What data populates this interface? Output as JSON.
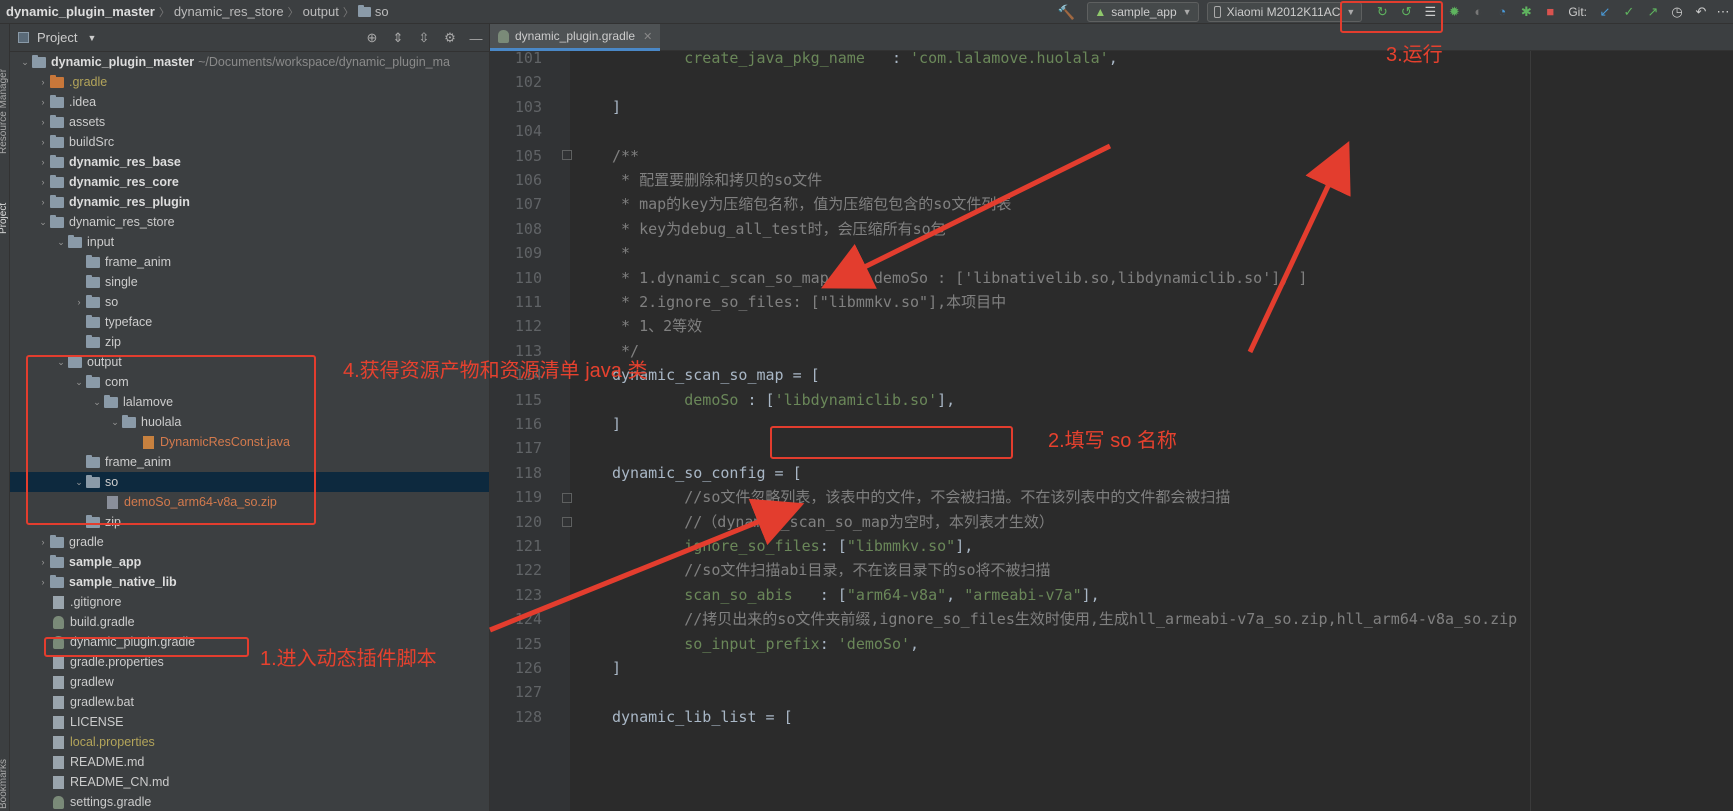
{
  "breadcrumb": [
    "dynamic_plugin_master",
    "dynamic_res_store",
    "output",
    "so"
  ],
  "toolbar": {
    "run_config": "sample_app",
    "device": "Xiaomi M2012K11AC",
    "git_label": "Git:"
  },
  "project_panel": {
    "title": "Project",
    "rows": [
      {
        "indent": 0,
        "chev": "open",
        "icon": "module",
        "label": "dynamic_plugin_master",
        "style": "bold",
        "note": "~/Documents/workspace/dynamic_plugin_ma"
      },
      {
        "indent": 1,
        "chev": "closed",
        "icon": "folder-orange",
        "label": ".gradle",
        "style": "yellow"
      },
      {
        "indent": 1,
        "chev": "closed",
        "icon": "folder",
        "label": ".idea",
        "style": "norm"
      },
      {
        "indent": 1,
        "chev": "closed",
        "icon": "folder",
        "label": "assets",
        "style": "norm"
      },
      {
        "indent": 1,
        "chev": "closed",
        "icon": "folder",
        "label": "buildSrc",
        "style": "norm"
      },
      {
        "indent": 1,
        "chev": "closed",
        "icon": "module",
        "label": "dynamic_res_base",
        "style": "bold"
      },
      {
        "indent": 1,
        "chev": "closed",
        "icon": "module",
        "label": "dynamic_res_core",
        "style": "bold"
      },
      {
        "indent": 1,
        "chev": "closed",
        "icon": "module",
        "label": "dynamic_res_plugin",
        "style": "bold"
      },
      {
        "indent": 1,
        "chev": "open",
        "icon": "folder",
        "label": "dynamic_res_store",
        "style": "norm"
      },
      {
        "indent": 2,
        "chev": "open",
        "icon": "folder",
        "label": "input",
        "style": "norm"
      },
      {
        "indent": 3,
        "chev": "none",
        "icon": "folder",
        "label": "frame_anim",
        "style": "norm"
      },
      {
        "indent": 3,
        "chev": "none",
        "icon": "folder",
        "label": "single",
        "style": "norm"
      },
      {
        "indent": 3,
        "chev": "closed",
        "icon": "folder",
        "label": "so",
        "style": "norm"
      },
      {
        "indent": 3,
        "chev": "none",
        "icon": "folder",
        "label": "typeface",
        "style": "norm"
      },
      {
        "indent": 3,
        "chev": "none",
        "icon": "folder",
        "label": "zip",
        "style": "norm"
      },
      {
        "indent": 2,
        "chev": "open",
        "icon": "folder",
        "label": "output",
        "style": "norm"
      },
      {
        "indent": 3,
        "chev": "open",
        "icon": "folder",
        "label": "com",
        "style": "norm"
      },
      {
        "indent": 4,
        "chev": "open",
        "icon": "folder",
        "label": "lalamove",
        "style": "norm"
      },
      {
        "indent": 5,
        "chev": "open",
        "icon": "folder",
        "label": "huolala",
        "style": "norm"
      },
      {
        "indent": 6,
        "chev": "none",
        "icon": "java",
        "label": "DynamicResConst.java",
        "style": "orange"
      },
      {
        "indent": 3,
        "chev": "none",
        "icon": "folder",
        "label": "frame_anim",
        "style": "norm"
      },
      {
        "indent": 3,
        "chev": "open",
        "icon": "folder",
        "label": "so",
        "style": "norm",
        "selected": true
      },
      {
        "indent": 4,
        "chev": "none",
        "icon": "zip",
        "label": "demoSo_arm64-v8a_so.zip",
        "style": "orange"
      },
      {
        "indent": 3,
        "chev": "none",
        "icon": "folder",
        "label": "zip",
        "style": "norm"
      },
      {
        "indent": 1,
        "chev": "closed",
        "icon": "folder",
        "label": "gradle",
        "style": "norm"
      },
      {
        "indent": 1,
        "chev": "closed",
        "icon": "module",
        "label": "sample_app",
        "style": "bold"
      },
      {
        "indent": 1,
        "chev": "closed",
        "icon": "module",
        "label": "sample_native_lib",
        "style": "bold"
      },
      {
        "indent": 1,
        "chev": "none",
        "icon": "file",
        "label": ".gitignore",
        "style": "norm"
      },
      {
        "indent": 1,
        "chev": "none",
        "icon": "gradle",
        "label": "build.gradle",
        "style": "norm"
      },
      {
        "indent": 1,
        "chev": "none",
        "icon": "gradle",
        "label": "dynamic_plugin.gradle",
        "style": "norm"
      },
      {
        "indent": 1,
        "chev": "none",
        "icon": "file",
        "label": "gradle.properties",
        "style": "norm"
      },
      {
        "indent": 1,
        "chev": "none",
        "icon": "file",
        "label": "gradlew",
        "style": "norm"
      },
      {
        "indent": 1,
        "chev": "none",
        "icon": "file",
        "label": "gradlew.bat",
        "style": "norm"
      },
      {
        "indent": 1,
        "chev": "none",
        "icon": "file",
        "label": "LICENSE",
        "style": "norm"
      },
      {
        "indent": 1,
        "chev": "none",
        "icon": "file",
        "label": "local.properties",
        "style": "yellow"
      },
      {
        "indent": 1,
        "chev": "none",
        "icon": "file",
        "label": "README.md",
        "style": "norm"
      },
      {
        "indent": 1,
        "chev": "none",
        "icon": "file",
        "label": "README_CN.md",
        "style": "norm"
      },
      {
        "indent": 1,
        "chev": "none",
        "icon": "gradle",
        "label": "settings.gradle",
        "style": "norm"
      }
    ]
  },
  "editor": {
    "tab_label": "dynamic_plugin.gradle",
    "lines": [
      {
        "n": "101",
        "parts": [
          [
            "id",
            "        "
          ],
          [
            "str",
            "create_java_pkg_name"
          ],
          [
            "id",
            "   : "
          ],
          [
            "str",
            "'com.lalamove.huolala'"
          ],
          [
            "id",
            ","
          ]
        ]
      },
      {
        "n": "102",
        "parts": []
      },
      {
        "n": "103",
        "parts": [
          [
            "id",
            "]"
          ]
        ]
      },
      {
        "n": "104",
        "parts": []
      },
      {
        "n": "105",
        "parts": [
          [
            "com",
            "/**"
          ]
        ]
      },
      {
        "n": "106",
        "parts": [
          [
            "com",
            " * 配置要删除和拷贝的so文件"
          ]
        ]
      },
      {
        "n": "107",
        "parts": [
          [
            "com",
            " * map的key为压缩包名称，值为压缩包包含的so文件列表"
          ]
        ]
      },
      {
        "n": "108",
        "parts": [
          [
            "com",
            " * key为debug_all_test时，会压缩所有so包"
          ]
        ]
      },
      {
        "n": "109",
        "parts": [
          [
            "com",
            " *"
          ]
        ]
      },
      {
        "n": "110",
        "parts": [
          [
            "com",
            " * 1.dynamic_scan_so_map = [ demoSo : ['libnativelib.so,libdynamiclib.so'], ]"
          ]
        ]
      },
      {
        "n": "111",
        "parts": [
          [
            "com",
            " * 2.ignore_so_files: [\"libmmkv.so\"],本项目中"
          ]
        ]
      },
      {
        "n": "112",
        "parts": [
          [
            "com",
            " * 1、2等效"
          ]
        ]
      },
      {
        "n": "113",
        "parts": [
          [
            "com",
            " */"
          ]
        ]
      },
      {
        "n": "114",
        "parts": [
          [
            "id",
            "dynamic_scan_so_map = ["
          ]
        ]
      },
      {
        "n": "115",
        "parts": [
          [
            "id",
            "        "
          ],
          [
            "str",
            "demoSo"
          ],
          [
            "id",
            " : ["
          ],
          [
            "str",
            "'libdynamiclib.so'"
          ],
          [
            "id",
            "],"
          ]
        ]
      },
      {
        "n": "116",
        "parts": [
          [
            "id",
            "]"
          ]
        ]
      },
      {
        "n": "117",
        "parts": []
      },
      {
        "n": "118",
        "parts": [
          [
            "id",
            "dynamic_so_config = ["
          ]
        ]
      },
      {
        "n": "119",
        "parts": [
          [
            "com",
            "        //so文件忽略列表，该表中的文件，不会被扫描。不在该列表中的文件都会被扫描"
          ]
        ]
      },
      {
        "n": "120",
        "parts": [
          [
            "com",
            "        //（dynamic_scan_so_map为空时，本列表才生效）"
          ]
        ]
      },
      {
        "n": "121",
        "parts": [
          [
            "id",
            "        "
          ],
          [
            "str",
            "ignore_so_files"
          ],
          [
            "id",
            ": ["
          ],
          [
            "str",
            "\"libmmkv.so\""
          ],
          [
            "id",
            "],"
          ]
        ]
      },
      {
        "n": "122",
        "parts": [
          [
            "com",
            "        //so文件扫描abi目录，不在该目录下的so将不被扫描"
          ]
        ]
      },
      {
        "n": "123",
        "parts": [
          [
            "id",
            "        "
          ],
          [
            "str",
            "scan_so_abis"
          ],
          [
            "id",
            "   : ["
          ],
          [
            "str",
            "\"arm64-v8a\""
          ],
          [
            "id",
            ", "
          ],
          [
            "str",
            "\"armeabi-v7a\""
          ],
          [
            "id",
            "],"
          ]
        ]
      },
      {
        "n": "124",
        "parts": [
          [
            "com",
            "        //拷贝出来的so文件夹前缀,ignore_so_files生效时使用,生成hll_armeabi-v7a_so.zip,hll_arm64-v8a_so.zip"
          ]
        ]
      },
      {
        "n": "125",
        "parts": [
          [
            "id",
            "        "
          ],
          [
            "str",
            "so_input_prefix"
          ],
          [
            "id",
            ": "
          ],
          [
            "str",
            "'demoSo'"
          ],
          [
            "id",
            ","
          ]
        ]
      },
      {
        "n": "126",
        "parts": [
          [
            "id",
            "]"
          ]
        ]
      },
      {
        "n": "127",
        "parts": []
      },
      {
        "n": "128",
        "parts": [
          [
            "id",
            "dynamic_lib_list = ["
          ]
        ]
      }
    ]
  },
  "annotations": {
    "step1": "1.进入动态插件脚本",
    "step2": "2.填写 so 名称",
    "step3": "3.运行",
    "step4": "4.获得资源产物和资源清单 java 类"
  },
  "side_labels": {
    "resource_manager": "Resource Manager",
    "project": "Project",
    "bookmarks": "Bookmarks"
  },
  "colors": {
    "accent_red": "#e33d2e",
    "selection": "#0d293e",
    "tab_underline": "#4a88c7"
  }
}
